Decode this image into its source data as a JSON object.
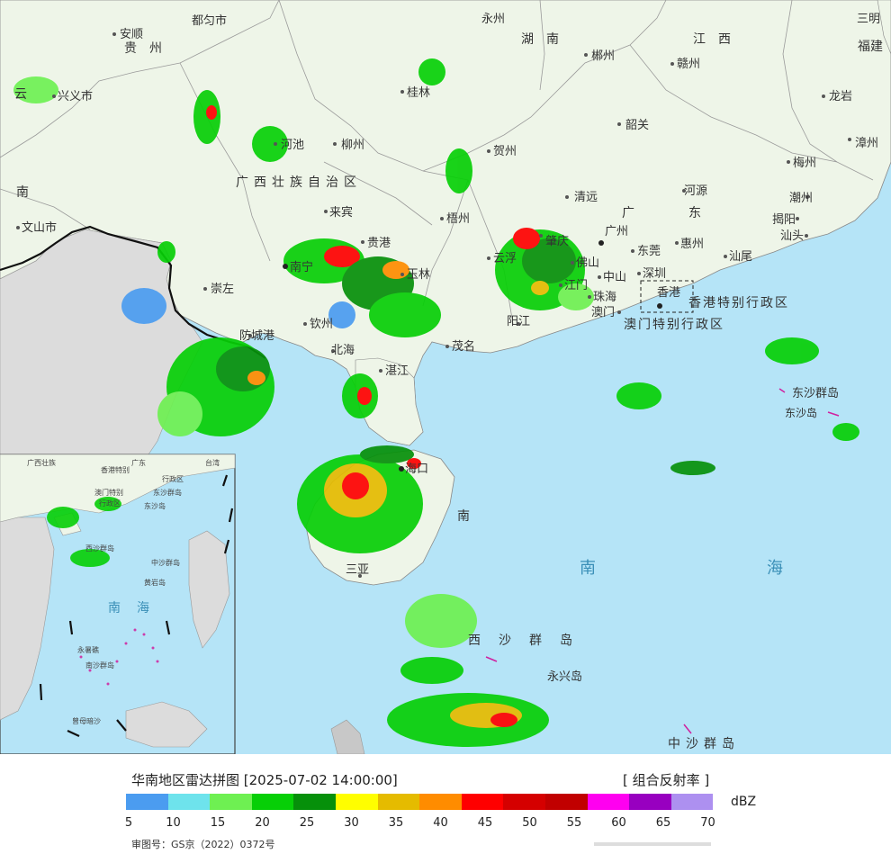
{
  "legend": {
    "title": "华南地区雷达拼图 [2025-07-02 14:00:00]",
    "product": "[ 组合反射率 ]",
    "unit": "dBZ",
    "approval": "审图号：GS京（2022）0372号",
    "colors": [
      "#4b9cf0",
      "#6ee3ec",
      "#6ef052",
      "#07cf07",
      "#06900a",
      "#fffe00",
      "#e5bb00",
      "#ff8c00",
      "#ff0000",
      "#d50000",
      "#c10000",
      "#ff00f0",
      "#9800c0",
      "#ad90f0"
    ],
    "ticks": [
      "5",
      "10",
      "15",
      "20",
      "25",
      "30",
      "35",
      "40",
      "45",
      "50",
      "55",
      "60",
      "65",
      "70"
    ]
  },
  "map": {
    "provinces": {
      "guizhou": "贵州",
      "hunan": "湖南",
      "jiangxi": "江西",
      "fujian": "福建",
      "guangxi": "广西壮族自治区",
      "guangdong": "广东",
      "yunnan": "云南",
      "hainan": "海南",
      "south_china_sea": "南海",
      "hk_sar": "香港特别行政区",
      "macau_sar": "澳门特别行政区",
      "dongsha_islands": "东沙群岛",
      "dongsha_isl": "东沙岛",
      "xisha_islands": "西沙群岛",
      "yongxing": "永兴岛",
      "zhongsha_islands": "中沙群岛"
    },
    "cities": [
      "都匀市",
      "安顺",
      "兴义市",
      "文山市",
      "桂林",
      "柳州",
      "河池",
      "来宾",
      "南宁",
      "崇左",
      "钦州",
      "北海",
      "防城港",
      "梧州",
      "贺州",
      "玉林",
      "贵港",
      "茂名",
      "湛江",
      "阳江",
      "云浮",
      "肇庆",
      "佛山",
      "江门",
      "中山",
      "珠海",
      "深圳",
      "东莞",
      "广州",
      "清远",
      "韶关",
      "郴州",
      "赣州",
      "龙岩",
      "漳州",
      "梅州",
      "潮州",
      "揭阳",
      "汕头",
      "河源",
      "惠州",
      "汕尾",
      "海口",
      "三亚",
      "香港",
      "澳门",
      "三明",
      "永州"
    ],
    "inset_labels": {
      "sea": "南海",
      "zhongsha": "中沙群岛",
      "huangyan": "黄岩岛",
      "nansha": "南沙群岛",
      "zengmu": "曾母暗沙",
      "yongshu": "永暑礁",
      "hk": "香港特别",
      "hk2": "行政区",
      "mo": "澳门特别",
      "mo2": "行政区",
      "dongsha": "东沙群岛",
      "dongsha_isl": "东沙岛",
      "taiwan": "台湾",
      "guangxi_inset": "广西壮族",
      "guangdong_inset": "广东",
      "xisha_inset": "西沙群岛"
    }
  }
}
